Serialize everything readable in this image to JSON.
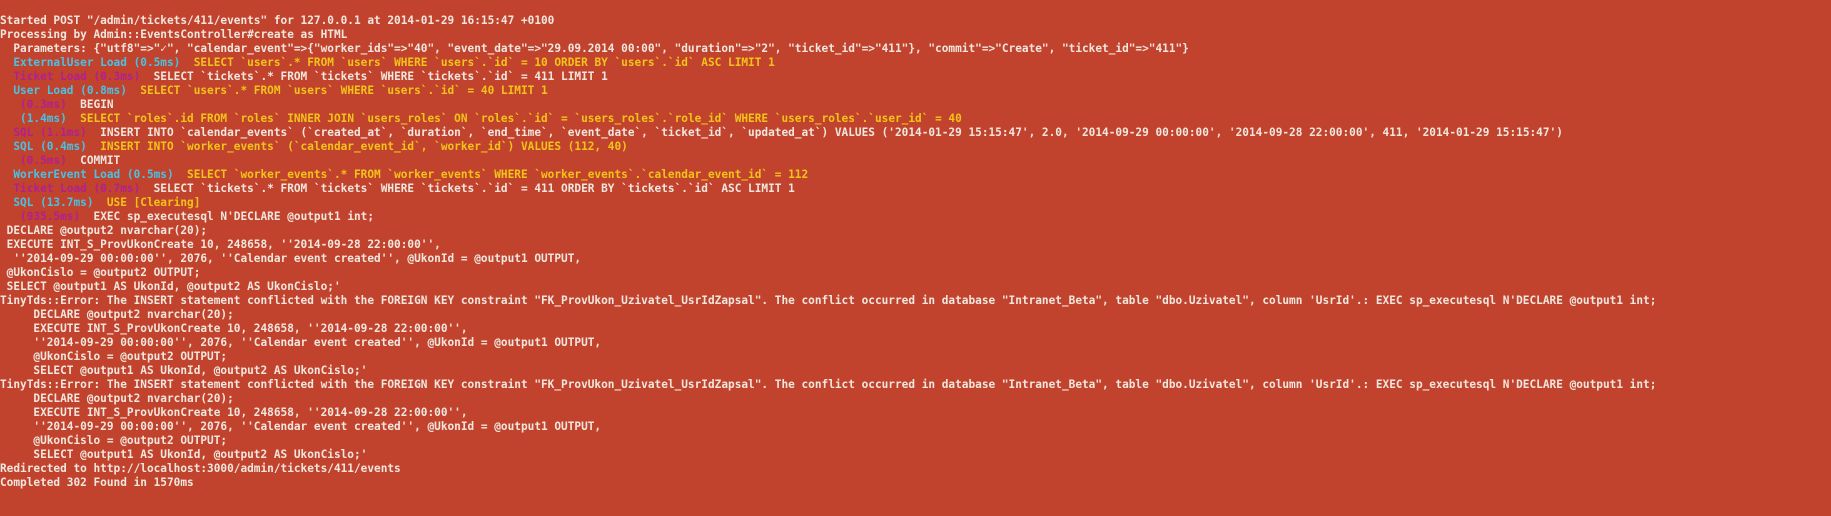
{
  "colors": {
    "background": "#C2432D",
    "text": "#F2E7DE",
    "label_cyan": "#49C1E3",
    "label_magenta": "#B0208F",
    "sql_yellow": "#F2C418"
  },
  "lines": [
    {
      "segs": [
        {
          "t": "Started POST \"/admin/tickets/411/events\" for 127.0.0.1 at 2014-01-29 16:15:47 +0100",
          "c": "text"
        }
      ]
    },
    {
      "segs": [
        {
          "t": "Processing by Admin::EventsController#create as HTML",
          "c": "text"
        }
      ]
    },
    {
      "segs": [
        {
          "t": "  Parameters: {\"utf8\"=>\"✓\", \"calendar_event\"=>{\"worker_ids\"=>\"40\", \"event_date\"=>\"29.09.2014 00:00\", \"duration\"=>\"2\", \"ticket_id\"=>\"411\"}, \"commit\"=>\"Create\", \"ticket_id\"=>\"411\"}",
          "c": "text"
        }
      ]
    },
    {
      "segs": [
        {
          "t": "  ExternalUser Load (0.5ms)",
          "c": "label_cyan"
        },
        {
          "t": "  SELECT `users`.* FROM `users` WHERE `users`.`id` = 10 ORDER BY `users`.`id` ASC LIMIT 1",
          "c": "sql_yellow"
        }
      ]
    },
    {
      "segs": [
        {
          "t": "  Ticket Load (0.3ms)",
          "c": "label_magenta"
        },
        {
          "t": "  SELECT `tickets`.* FROM `tickets` WHERE `tickets`.`id` = 411 LIMIT 1",
          "c": "text"
        }
      ]
    },
    {
      "segs": [
        {
          "t": "  User Load (0.8ms)",
          "c": "label_cyan"
        },
        {
          "t": "  SELECT `users`.* FROM `users` WHERE `users`.`id` = 40 LIMIT 1",
          "c": "sql_yellow"
        }
      ]
    },
    {
      "segs": [
        {
          "t": "   (0.3ms)",
          "c": "label_magenta"
        },
        {
          "t": "  BEGIN",
          "c": "text"
        }
      ]
    },
    {
      "segs": [
        {
          "t": "   (1.4ms)",
          "c": "label_cyan"
        },
        {
          "t": "  SELECT `roles`.id FROM `roles` INNER JOIN `users_roles` ON `roles`.`id` = `users_roles`.`role_id` WHERE `users_roles`.`user_id` = 40",
          "c": "sql_yellow"
        }
      ]
    },
    {
      "segs": [
        {
          "t": "  SQL (1.1ms)",
          "c": "label_magenta"
        },
        {
          "t": "  INSERT INTO `calendar_events` (`created_at`, `duration`, `end_time`, `event_date`, `ticket_id`, `updated_at`) VALUES ('2014-01-29 15:15:47', 2.0, '2014-09-29 00:00:00', '2014-09-28 22:00:00', 411, '2014-01-29 15:15:47')",
          "c": "text"
        }
      ]
    },
    {
      "segs": [
        {
          "t": "  SQL (0.4ms)",
          "c": "label_cyan"
        },
        {
          "t": "  INSERT INTO `worker_events` (`calendar_event_id`, `worker_id`) VALUES (112, 40)",
          "c": "sql_yellow"
        }
      ]
    },
    {
      "segs": [
        {
          "t": "   (0.5ms)",
          "c": "label_magenta"
        },
        {
          "t": "  COMMIT",
          "c": "text"
        }
      ]
    },
    {
      "segs": [
        {
          "t": "  WorkerEvent Load (0.5ms)",
          "c": "label_cyan"
        },
        {
          "t": "  SELECT `worker_events`.* FROM `worker_events` WHERE `worker_events`.`calendar_event_id` = 112",
          "c": "sql_yellow"
        }
      ]
    },
    {
      "segs": [
        {
          "t": "  Ticket Load (0.7ms)",
          "c": "label_magenta"
        },
        {
          "t": "  SELECT `tickets`.* FROM `tickets` WHERE `tickets`.`id` = 411 ORDER BY `tickets`.`id` ASC LIMIT 1",
          "c": "text"
        }
      ]
    },
    {
      "segs": [
        {
          "t": "  SQL (13.7ms)",
          "c": "label_cyan"
        },
        {
          "t": "  USE [Clearing]",
          "c": "sql_yellow"
        }
      ]
    },
    {
      "segs": [
        {
          "t": "   (935.5ms)",
          "c": "label_magenta"
        },
        {
          "t": "  EXEC sp_executesql N'DECLARE @output1 int;",
          "c": "text"
        }
      ]
    },
    {
      "segs": [
        {
          "t": " DECLARE @output2 nvarchar(20);",
          "c": "text"
        }
      ]
    },
    {
      "segs": [
        {
          "t": " EXECUTE INT_S_ProvUkonCreate 10, 248658, ''2014-09-28 22:00:00'',",
          "c": "text"
        }
      ]
    },
    {
      "segs": [
        {
          "t": "  ''2014-09-29 00:00:00'', 2076, ''Calendar event created'', @UkonId = @output1 OUTPUT,",
          "c": "text"
        }
      ]
    },
    {
      "segs": [
        {
          "t": " @UkonCislo = @output2 OUTPUT;",
          "c": "text"
        }
      ]
    },
    {
      "segs": [
        {
          "t": " SELECT @output1 AS UkonId, @output2 AS UkonCislo;'",
          "c": "text"
        }
      ]
    },
    {
      "segs": [
        {
          "t": "TinyTds::Error: The INSERT statement conflicted with the FOREIGN KEY constraint \"FK_ProvUkon_Uzivatel_UsrIdZapsal\". The conflict occurred in database \"Intranet_Beta\", table \"dbo.Uzivatel\", column 'UsrId'.: EXEC sp_executesql N'DECLARE @output1 int;",
          "c": "text"
        }
      ]
    },
    {
      "segs": [
        {
          "t": "     DECLARE @output2 nvarchar(20);",
          "c": "text"
        }
      ]
    },
    {
      "segs": [
        {
          "t": "     EXECUTE INT_S_ProvUkonCreate 10, 248658, ''2014-09-28 22:00:00'',",
          "c": "text"
        }
      ]
    },
    {
      "segs": [
        {
          "t": "     ''2014-09-29 00:00:00'', 2076, ''Calendar event created'', @UkonId = @output1 OUTPUT,",
          "c": "text"
        }
      ]
    },
    {
      "segs": [
        {
          "t": "     @UkonCislo = @output2 OUTPUT;",
          "c": "text"
        }
      ]
    },
    {
      "segs": [
        {
          "t": "     SELECT @output1 AS UkonId, @output2 AS UkonCislo;'",
          "c": "text"
        }
      ]
    },
    {
      "segs": [
        {
          "t": "TinyTds::Error: The INSERT statement conflicted with the FOREIGN KEY constraint \"FK_ProvUkon_Uzivatel_UsrIdZapsal\". The conflict occurred in database \"Intranet_Beta\", table \"dbo.Uzivatel\", column 'UsrId'.: EXEC sp_executesql N'DECLARE @output1 int;",
          "c": "text"
        }
      ]
    },
    {
      "segs": [
        {
          "t": "     DECLARE @output2 nvarchar(20);",
          "c": "text"
        }
      ]
    },
    {
      "segs": [
        {
          "t": "     EXECUTE INT_S_ProvUkonCreate 10, 248658, ''2014-09-28 22:00:00'',",
          "c": "text"
        }
      ]
    },
    {
      "segs": [
        {
          "t": "     ''2014-09-29 00:00:00'', 2076, ''Calendar event created'', @UkonId = @output1 OUTPUT,",
          "c": "text"
        }
      ]
    },
    {
      "segs": [
        {
          "t": "     @UkonCislo = @output2 OUTPUT;",
          "c": "text"
        }
      ]
    },
    {
      "segs": [
        {
          "t": "     SELECT @output1 AS UkonId, @output2 AS UkonCislo;'",
          "c": "text"
        }
      ]
    },
    {
      "segs": [
        {
          "t": "Redirected to http://localhost:3000/admin/tickets/411/events",
          "c": "text"
        }
      ]
    },
    {
      "segs": [
        {
          "t": "Completed 302 Found in 1570ms",
          "c": "text"
        }
      ]
    }
  ]
}
